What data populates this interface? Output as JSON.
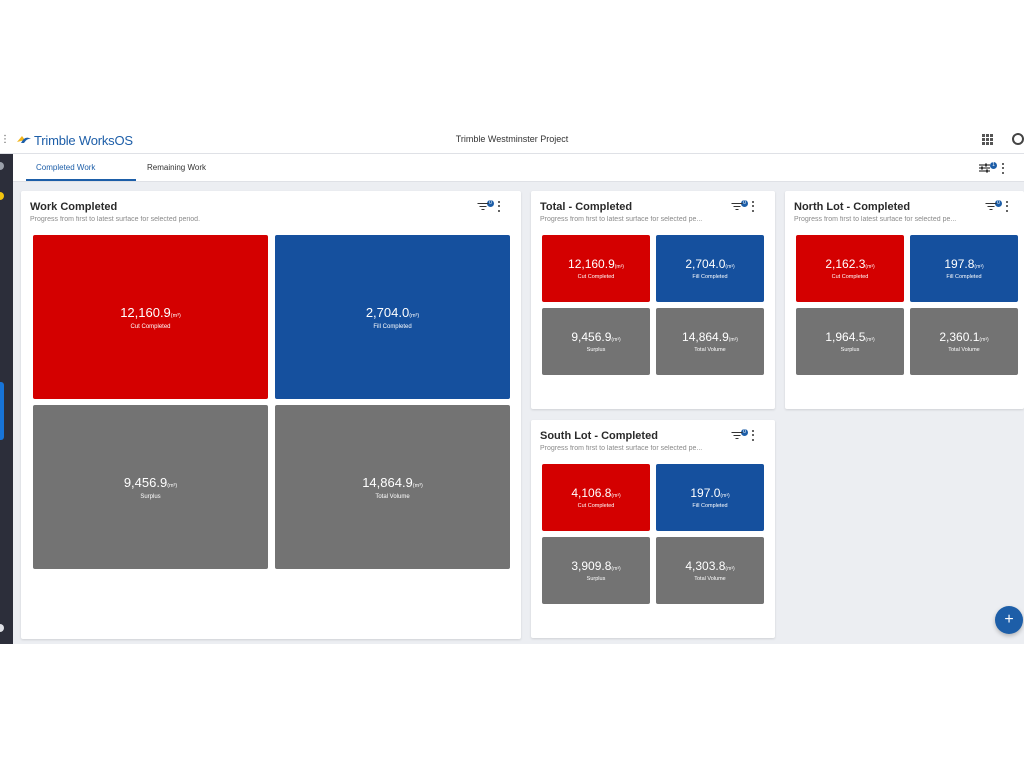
{
  "header": {
    "logo_brand": "Trimble",
    "logo_product": "WorksOS",
    "project_title": "Trimble Westminster Project"
  },
  "tabs": [
    {
      "label": "Completed Work",
      "active": true
    },
    {
      "label": "Remaining Work",
      "active": false
    }
  ],
  "colors": {
    "cut": "#d40000",
    "fill": "#15509e",
    "neutral": "#737373",
    "accent": "#1d5ea8"
  },
  "cards": {
    "work": {
      "title": "Work Completed",
      "subtitle": "Progress from first to latest surface for selected period.",
      "filter_badge": "0",
      "tiles": [
        {
          "value": "12,160.9",
          "unit": "(m³)",
          "label": "Cut Completed"
        },
        {
          "value": "2,704.0",
          "unit": "(m³)",
          "label": "Fill Completed"
        },
        {
          "value": "9,456.9",
          "unit": "(m³)",
          "label": "Surplus"
        },
        {
          "value": "14,864.9",
          "unit": "(m³)",
          "label": "Total Volume"
        }
      ]
    },
    "total": {
      "title": "Total - Completed",
      "subtitle": "Progress from first to latest surface for selected pe...",
      "filter_badge": "0",
      "tiles": [
        {
          "value": "12,160.9",
          "unit": "(m³)",
          "label": "Cut Completed"
        },
        {
          "value": "2,704.0",
          "unit": "(m³)",
          "label": "Fill Completed"
        },
        {
          "value": "9,456.9",
          "unit": "(m³)",
          "label": "Surplus"
        },
        {
          "value": "14,864.9",
          "unit": "(m³)",
          "label": "Total Volume"
        }
      ]
    },
    "north": {
      "title": "North Lot - Completed",
      "subtitle": "Progress from first to latest surface for selected pe...",
      "filter_badge": "0",
      "tiles": [
        {
          "value": "2,162.3",
          "unit": "(m³)",
          "label": "Cut Completed"
        },
        {
          "value": "197.8",
          "unit": "(m³)",
          "label": "Fill Completed"
        },
        {
          "value": "1,964.5",
          "unit": "(m³)",
          "label": "Surplus"
        },
        {
          "value": "2,360.1",
          "unit": "(m³)",
          "label": "Total Volume"
        }
      ]
    },
    "south": {
      "title": "South Lot - Completed",
      "subtitle": "Progress from first to latest surface for selected pe...",
      "filter_badge": "0",
      "tiles": [
        {
          "value": "4,106.8",
          "unit": "(m³)",
          "label": "Cut Completed"
        },
        {
          "value": "197.0",
          "unit": "(m³)",
          "label": "Fill Completed"
        },
        {
          "value": "3,909.8",
          "unit": "(m³)",
          "label": "Surplus"
        },
        {
          "value": "4,303.8",
          "unit": "(m³)",
          "label": "Total Volume"
        }
      ]
    }
  },
  "fab_label": "+"
}
